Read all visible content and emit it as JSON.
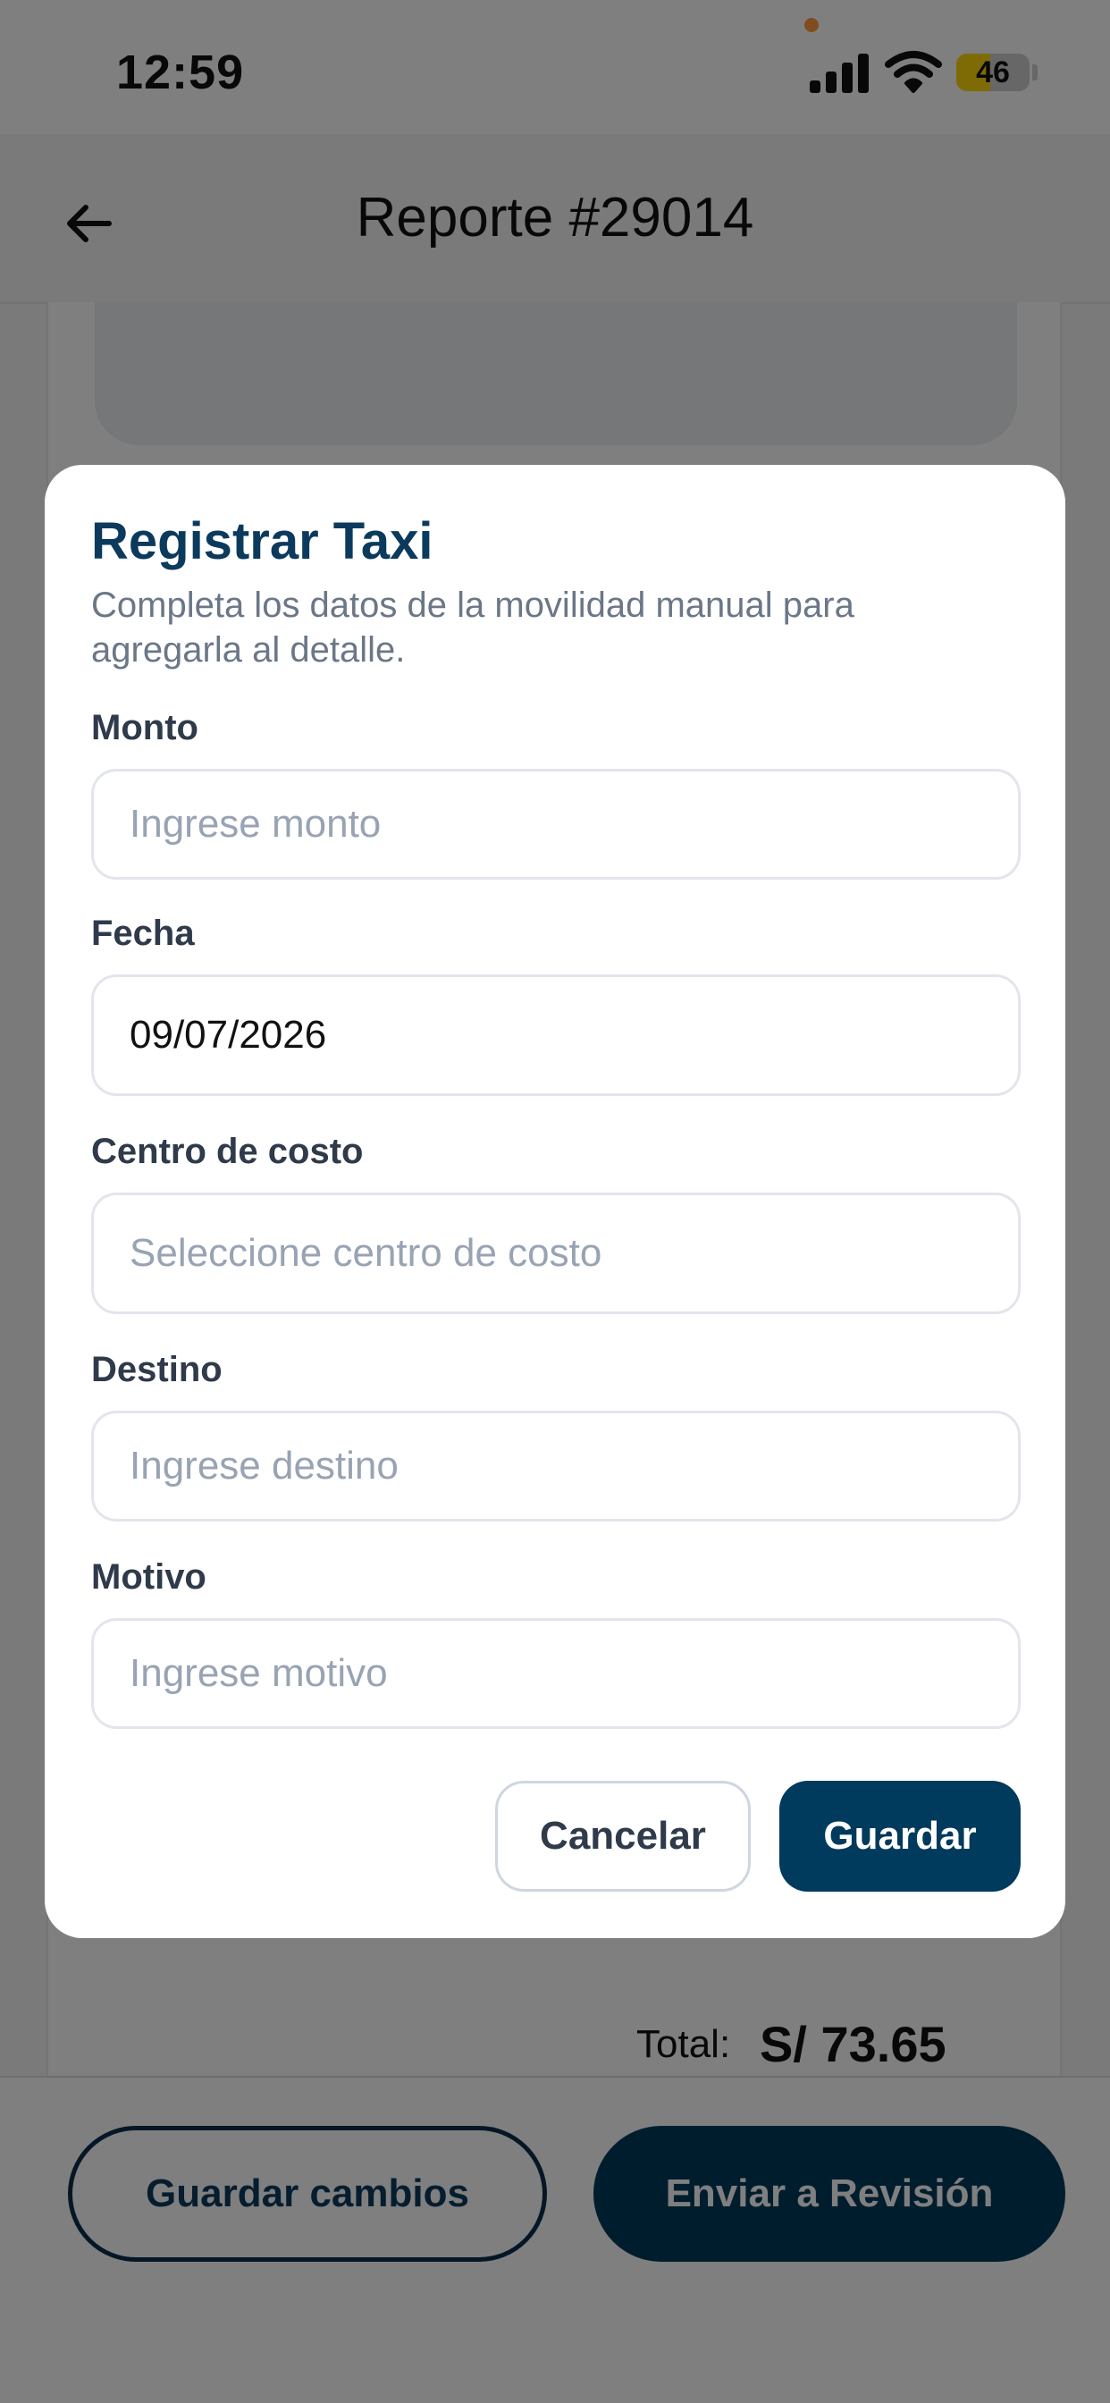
{
  "status_bar": {
    "time": "12:59",
    "battery_level": "46",
    "battery_percent": 46,
    "icons": [
      "signal-icon",
      "wifi-icon",
      "battery-icon"
    ]
  },
  "header": {
    "title": "Reporte #29014",
    "back_icon": "arrow-left-icon"
  },
  "summary": {
    "total_label": "Total:",
    "total_value": "S/ 73.65"
  },
  "footer": {
    "save_changes_label": "Guardar cambios",
    "send_review_label": "Enviar a Revisión"
  },
  "modal": {
    "title": "Registrar Taxi",
    "subtitle": "Completa los datos de la movilidad manual para agregarla al detalle.",
    "fields": {
      "monto": {
        "label": "Monto",
        "placeholder": "Ingrese monto",
        "value": ""
      },
      "fecha": {
        "label": "Fecha",
        "value": "09/07/2026"
      },
      "centro_costo": {
        "label": "Centro de costo",
        "placeholder": "Seleccione centro de costo"
      },
      "destino": {
        "label": "Destino",
        "placeholder": "Ingrese destino",
        "value": ""
      },
      "motivo": {
        "label": "Motivo",
        "placeholder": "Ingrese motivo",
        "value": ""
      }
    },
    "cancel_label": "Cancelar",
    "save_label": "Guardar"
  },
  "colors": {
    "primary": "#003a5c",
    "title": "#0b3a5c",
    "overlay": "rgba(0,0,0,0.5)",
    "battery": "#ffd60a"
  }
}
